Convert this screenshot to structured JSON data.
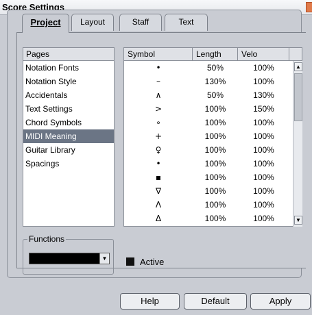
{
  "window": {
    "title": "Score Settings"
  },
  "tabs": {
    "project": "Project",
    "layout": "Layout",
    "staff": "Staff",
    "text": "Text"
  },
  "pages": {
    "header": "Pages",
    "items": [
      "Notation Fonts",
      "Notation Style",
      "Accidentals",
      "Text Settings",
      "Chord Symbols",
      "MIDI Meaning",
      "Guitar Library",
      "Spacings"
    ],
    "selected": "MIDI Meaning"
  },
  "table": {
    "columns": [
      "Symbol",
      "Length",
      "Velo"
    ],
    "rows": [
      {
        "symbol": "•",
        "length": "50%",
        "velo": "100%"
      },
      {
        "symbol": "–",
        "length": "130%",
        "velo": "100%"
      },
      {
        "symbol": "∧",
        "length": "50%",
        "velo": "130%"
      },
      {
        "symbol": ">",
        "length": "100%",
        "velo": "150%"
      },
      {
        "symbol": "∘",
        "length": "100%",
        "velo": "100%"
      },
      {
        "symbol": "+",
        "length": "100%",
        "velo": "100%"
      },
      {
        "symbol": "♀",
        "length": "100%",
        "velo": "100%"
      },
      {
        "symbol": "•",
        "length": "100%",
        "velo": "100%"
      },
      {
        "symbol": "▪",
        "length": "100%",
        "velo": "100%"
      },
      {
        "symbol": "∇",
        "length": "100%",
        "velo": "100%"
      },
      {
        "symbol": "Λ",
        "length": "100%",
        "velo": "100%"
      },
      {
        "symbol": "Δ",
        "length": "100%",
        "velo": "100%"
      }
    ]
  },
  "functions": {
    "label": "Functions",
    "value": ""
  },
  "active": {
    "label": "Active"
  },
  "buttons": {
    "help": "Help",
    "default": "Default",
    "apply": "Apply"
  },
  "icons": {
    "close": "close-icon",
    "scroll_up": "scroll-up-arrow-icon",
    "scroll_down": "scroll-down-arrow-icon",
    "dropdown": "chevron-down-icon"
  }
}
